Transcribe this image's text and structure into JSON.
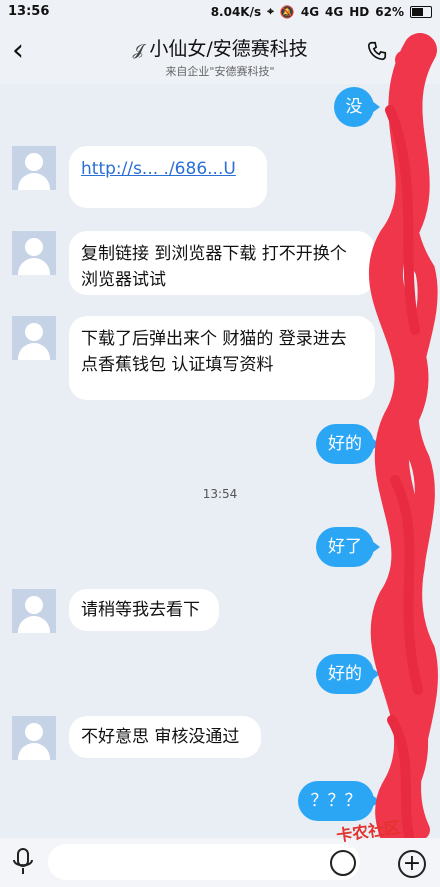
{
  "status_bar": {
    "time": "13:56",
    "net_speed": "8.04K/s",
    "signal_a": "4G",
    "signal_b": "4G",
    "hd": "HD",
    "battery": "62%"
  },
  "header": {
    "title": "小仙女/安德赛科技",
    "subtitle": "来自企业\"安德赛科技\""
  },
  "messages": [
    {
      "side": "right",
      "text": "没"
    },
    {
      "side": "left",
      "text": "http://s... ./686...U"
    },
    {
      "side": "left",
      "text": "复制链接  到浏览器下载 打不开换个浏览器试试"
    },
    {
      "side": "left",
      "text": "下载了后弹出来个 财猫的 登录进去 点香蕉钱包 认证填写资料"
    },
    {
      "side": "right",
      "text": "好的"
    },
    {
      "side": "right",
      "text": "好了"
    },
    {
      "side": "left",
      "text": "请稍等我去看下"
    },
    {
      "side": "right",
      "text": "好的"
    },
    {
      "side": "left",
      "text": "不好意思 审核没通过"
    },
    {
      "side": "right",
      "text": "？？？"
    }
  ],
  "timestamp": "13:54",
  "watermark": "卡农社区",
  "colors": {
    "accent": "#2aa6f5",
    "background": "#e9edf4",
    "scribble": "#f0364a"
  }
}
